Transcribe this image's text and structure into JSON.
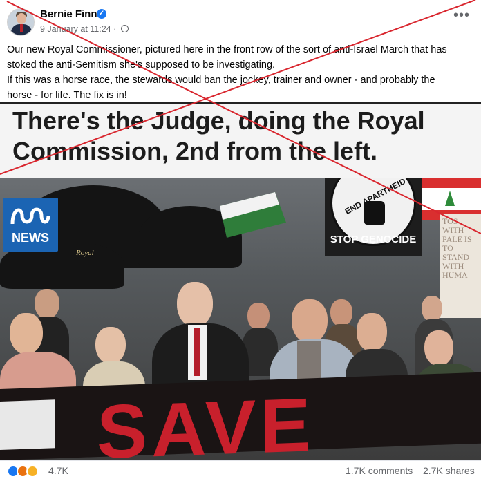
{
  "post": {
    "author": "Bernie Finn",
    "timestamp": "9 January at 11:24 ·",
    "text_lines": [
      "Our new Royal Commissioner, pictured here in the front row of the sort of anti-Israel March that has",
      "stoked the anti-Semitism she's supposed to be investigating.",
      "If this was a horse race, the stewards would ban the jockey, trainer and owner - and probably the",
      "horse - for life. The fix is in!"
    ]
  },
  "image": {
    "caption_line1": "There's the Judge, doing the Royal",
    "caption_line2": "Commission, 2nd from the left.",
    "logo_text": "NEWS",
    "sign_circle_text": "END APARTHEID",
    "sign_text": "STOP GENOCIDE",
    "placard_text": "TOS WITH PALE IS TO STAND WITH HUMA",
    "umbrella_text": "Royal",
    "banner_text": "SAVE"
  },
  "footer": {
    "reaction_count": "4.7K",
    "comments": "1.7K comments",
    "shares": "2.7K shares"
  },
  "colors": {
    "overlay_cross": "#d9262e",
    "facebook_blue": "#1877f2",
    "abc_blue": "#1b64b3",
    "banner_red": "#c8202c"
  },
  "icons": [
    "verified-badge-icon",
    "globe-icon",
    "more-options-icon",
    "like-reaction-icon",
    "angry-reaction-icon",
    "wow-reaction-icon"
  ]
}
